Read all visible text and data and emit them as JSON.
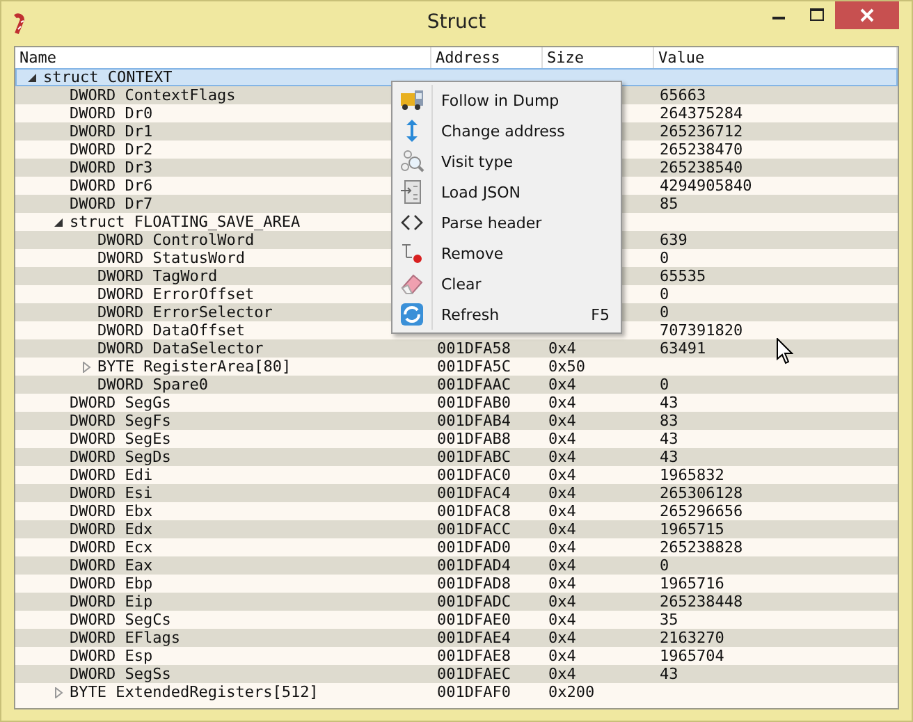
{
  "window": {
    "title": "Struct"
  },
  "table": {
    "columns": [
      "Name",
      "Address",
      "Size",
      "Value"
    ],
    "rows": [
      {
        "name": "struct CONTEXT",
        "expanded": true,
        "selected": true,
        "children": [
          {
            "name": "DWORD ContextFlags",
            "value": "65663",
            "selected": false
          },
          {
            "name": "DWORD Dr0",
            "value": "264375284",
            "selected": false
          },
          {
            "name": "DWORD Dr1",
            "value": "265236712",
            "selected": false
          },
          {
            "name": "DWORD Dr2",
            "value": "265238470",
            "selected": false
          },
          {
            "name": "DWORD Dr3",
            "value": "265238540",
            "selected": false
          },
          {
            "name": "DWORD Dr6",
            "value": "4294905840",
            "selected": false
          },
          {
            "name": "DWORD Dr7",
            "value": "85",
            "selected": false
          },
          {
            "name": "struct FLOATING_SAVE_AREA",
            "expanded": true,
            "selected": false,
            "children": [
              {
                "name": "DWORD ControlWord",
                "value": "639",
                "selected": false
              },
              {
                "name": "DWORD StatusWord",
                "value": "0",
                "selected": false
              },
              {
                "name": "DWORD TagWord",
                "value": "65535",
                "selected": false
              },
              {
                "name": "DWORD ErrorOffset",
                "value": "0",
                "selected": false
              },
              {
                "name": "DWORD ErrorSelector",
                "value": "0",
                "selected": false
              },
              {
                "name": "DWORD DataOffset",
                "value": "707391820",
                "selected": false
              },
              {
                "name": "DWORD DataSelector",
                "address": "001DFA58",
                "size": "0x4",
                "value": "63491",
                "selected": false
              },
              {
                "name": "BYTE RegisterArea[80]",
                "address": "001DFA5C",
                "size": "0x50",
                "expanded": false,
                "selected": false
              },
              {
                "name": "DWORD Spare0",
                "address": "001DFAAC",
                "size": "0x4",
                "value": "0",
                "selected": false
              }
            ]
          },
          {
            "name": "DWORD SegGs",
            "address": "001DFAB0",
            "size": "0x4",
            "value": "43",
            "selected": false
          },
          {
            "name": "DWORD SegFs",
            "address": "001DFAB4",
            "size": "0x4",
            "value": "83",
            "selected": false
          },
          {
            "name": "DWORD SegEs",
            "address": "001DFAB8",
            "size": "0x4",
            "value": "43",
            "selected": false
          },
          {
            "name": "DWORD SegDs",
            "address": "001DFABC",
            "size": "0x4",
            "value": "43",
            "selected": false
          },
          {
            "name": "DWORD Edi",
            "address": "001DFAC0",
            "size": "0x4",
            "value": "1965832",
            "selected": false
          },
          {
            "name": "DWORD Esi",
            "address": "001DFAC4",
            "size": "0x4",
            "value": "265306128",
            "selected": false
          },
          {
            "name": "DWORD Ebx",
            "address": "001DFAC8",
            "size": "0x4",
            "value": "265296656",
            "selected": false
          },
          {
            "name": "DWORD Edx",
            "address": "001DFACC",
            "size": "0x4",
            "value": "1965715",
            "selected": false
          },
          {
            "name": "DWORD Ecx",
            "address": "001DFAD0",
            "size": "0x4",
            "value": "265238828",
            "selected": false
          },
          {
            "name": "DWORD Eax",
            "address": "001DFAD4",
            "size": "0x4",
            "value": "0",
            "selected": false
          },
          {
            "name": "DWORD Ebp",
            "address": "001DFAD8",
            "size": "0x4",
            "value": "1965716",
            "selected": false
          },
          {
            "name": "DWORD Eip",
            "address": "001DFADC",
            "size": "0x4",
            "value": "265238448",
            "selected": false
          },
          {
            "name": "DWORD SegCs",
            "address": "001DFAE0",
            "size": "0x4",
            "value": "35",
            "selected": false
          },
          {
            "name": "DWORD EFlags",
            "address": "001DFAE4",
            "size": "0x4",
            "value": "2163270",
            "selected": false
          },
          {
            "name": "DWORD Esp",
            "address": "001DFAE8",
            "size": "0x4",
            "value": "1965704",
            "selected": false
          },
          {
            "name": "DWORD SegSs",
            "address": "001DFAEC",
            "size": "0x4",
            "value": "43",
            "selected": false
          },
          {
            "name": "BYTE ExtendedRegisters[512]",
            "address": "001DFAF0",
            "size": "0x200",
            "expanded": false,
            "selected": false
          }
        ]
      }
    ]
  },
  "context_menu": {
    "items": [
      {
        "kind": "truck",
        "label": "Follow in Dump"
      },
      {
        "kind": "updown",
        "label": "Change address"
      },
      {
        "kind": "visit",
        "label": "Visit type"
      },
      {
        "kind": "load",
        "label": "Load JSON"
      },
      {
        "kind": "brackets",
        "label": "Parse header"
      },
      {
        "kind": "remove",
        "label": "Remove"
      },
      {
        "kind": "eraser",
        "label": "Clear"
      },
      {
        "kind": "refresh",
        "label": "Refresh",
        "shortcut": "F5"
      }
    ]
  }
}
